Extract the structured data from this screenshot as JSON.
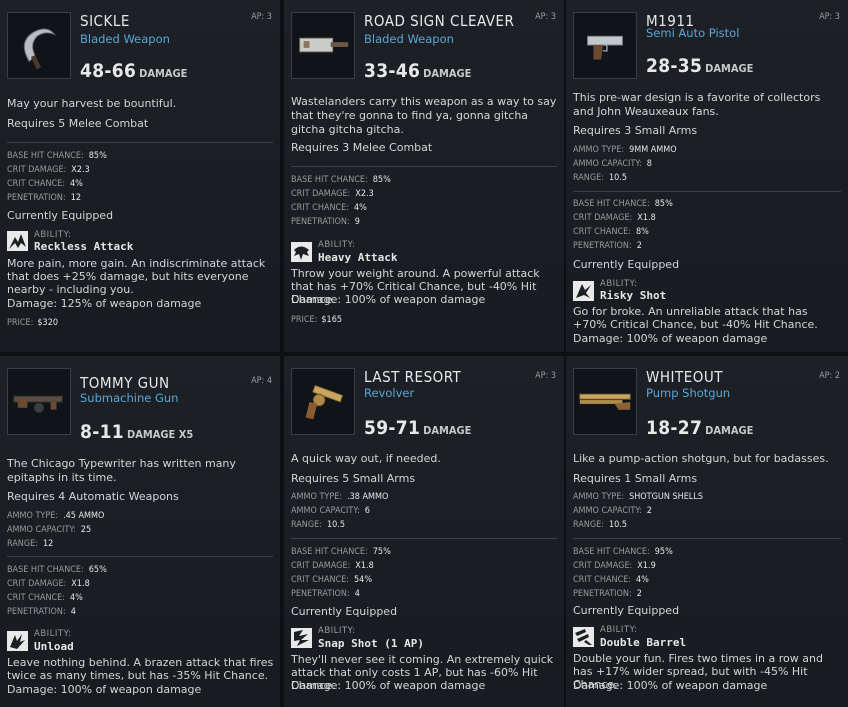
{
  "cards": [
    {
      "name": "SICKLE",
      "weapon_type": "Bladed Weapon",
      "ap": "AP: 3",
      "damage_value": "48-66",
      "damage_label": "DAMAGE",
      "flavor": "May your harvest be bountiful.",
      "requires": "Requires 5 Melee Combat",
      "stats": [
        {
          "label": "Base Hit Chance:",
          "value": "85%"
        },
        {
          "label": "Crit Damage:",
          "value": "X2.3"
        },
        {
          "label": "Crit Chance:",
          "value": "4%"
        },
        {
          "label": "Penetration:",
          "value": "12"
        }
      ],
      "equipped": "Currently Equipped",
      "ability_label": "ABILITY:",
      "ability_name": "Reckless Attack",
      "ability_desc": "More pain, more gain. An indiscriminate attack that does +25% damage, but hits everyone nearby - including you.",
      "ability_damage": "Damage: 125% of weapon damage",
      "price_label": "PRICE:",
      "price_value": "$320"
    },
    {
      "name": "ROAD SIGN CLEAVER",
      "weapon_type": "Bladed Weapon",
      "ap": "AP: 3",
      "damage_value": "33-46",
      "damage_label": "DAMAGE",
      "flavor": "Wastelanders carry this weapon as a way to say that they're gonna to find ya, gonna gitcha gitcha gitcha gitcha.",
      "requires": "Requires 3 Melee Combat",
      "stats": [
        {
          "label": "Base Hit Chance:",
          "value": "85%"
        },
        {
          "label": "Crit Damage:",
          "value": "X2.3"
        },
        {
          "label": "Crit Chance:",
          "value": "4%"
        },
        {
          "label": "Penetration:",
          "value": "9"
        }
      ],
      "ability_label": "ABILITY:",
      "ability_name": "Heavy Attack",
      "ability_desc": "Throw your weight around. A powerful attack that has +70% Critical Chance, but -40% Hit Chance.",
      "ability_damage": "Damage: 100% of weapon damage",
      "price_label": "PRICE:",
      "price_value": "$165"
    },
    {
      "name": "M1911",
      "weapon_type": "Semi Auto Pistol",
      "ap": "AP: 3",
      "damage_value": "28-35",
      "damage_label": "DAMAGE",
      "flavor": "This pre-war design is a favorite of collectors and John Weauxeaux fans.",
      "requires": "Requires 3 Small Arms",
      "ammo": [
        {
          "label": "Ammo Type:",
          "value": "9MM AMMO"
        },
        {
          "label": "Ammo Capacity:",
          "value": "8"
        },
        {
          "label": "Range:",
          "value": "10.5"
        }
      ],
      "stats": [
        {
          "label": "Base Hit Chance:",
          "value": "85%"
        },
        {
          "label": "Crit Damage:",
          "value": "X1.8"
        },
        {
          "label": "Crit Chance:",
          "value": "8%"
        },
        {
          "label": "Penetration:",
          "value": "2"
        }
      ],
      "equipped": "Currently Equipped",
      "ability_label": "ABILITY:",
      "ability_name": "Risky Shot",
      "ability_desc": "Go for broke. An unreliable attack that has +70% Critical Chance, but -40% Hit Chance.",
      "ability_damage": "Damage: 100% of weapon damage"
    },
    {
      "name": "TOMMY GUN",
      "weapon_type": "Submachine Gun",
      "ap": "AP: 4",
      "damage_value": "8-11",
      "damage_label": "DAMAGE X5",
      "flavor": "The Chicago Typewriter has written many epitaphs in its time.",
      "requires": "Requires 4 Automatic Weapons",
      "ammo": [
        {
          "label": "Ammo Type:",
          "value": ".45 AMMO"
        },
        {
          "label": "Ammo Capacity:",
          "value": "25"
        },
        {
          "label": "Range:",
          "value": "12"
        }
      ],
      "stats": [
        {
          "label": "Base Hit Chance:",
          "value": "65%"
        },
        {
          "label": "Crit Damage:",
          "value": "X1.8"
        },
        {
          "label": "Crit Chance:",
          "value": "4%"
        },
        {
          "label": "Penetration:",
          "value": "4"
        }
      ],
      "ability_label": "ABILITY:",
      "ability_name": "Unload",
      "ability_desc": "Leave nothing behind. A brazen attack that fires twice as many times, but has -35% Hit Chance.",
      "ability_damage": "Damage: 100% of weapon damage"
    },
    {
      "name": "LAST RESORT",
      "weapon_type": "Revolver",
      "ap": "AP: 3",
      "damage_value": "59-71",
      "damage_label": "DAMAGE",
      "flavor": "A quick way out, if needed.",
      "requires": "Requires 5 Small Arms",
      "ammo": [
        {
          "label": "Ammo Type:",
          "value": ".38 AMMO"
        },
        {
          "label": "Ammo Capacity:",
          "value": "6"
        },
        {
          "label": "Range:",
          "value": "10.5"
        }
      ],
      "stats": [
        {
          "label": "Base Hit Chance:",
          "value": "75%"
        },
        {
          "label": "Crit Damage:",
          "value": "X1.8"
        },
        {
          "label": "Crit Chance:",
          "value": "54%"
        },
        {
          "label": "Penetration:",
          "value": "4"
        }
      ],
      "equipped": "Currently Equipped",
      "ability_label": "ABILITY:",
      "ability_name": "Snap Shot (1 AP)",
      "ability_desc": "They'll never see it coming. An extremely quick attack that only costs 1 AP, but has -60% Hit Chance.",
      "ability_damage": "Damage: 100% of weapon damage"
    },
    {
      "name": "WHITEOUT",
      "weapon_type": "Pump Shotgun",
      "ap": "AP: 2",
      "damage_value": "18-27",
      "damage_label": "DAMAGE",
      "flavor": "Like a pump-action shotgun, but for badasses.",
      "requires": "Requires 1 Small Arms",
      "ammo": [
        {
          "label": "Ammo Type:",
          "value": "SHOTGUN SHELLS"
        },
        {
          "label": "Ammo Capacity:",
          "value": "2"
        },
        {
          "label": "Range:",
          "value": "10.5"
        }
      ],
      "stats": [
        {
          "label": "Base Hit Chance:",
          "value": "95%"
        },
        {
          "label": "Crit Damage:",
          "value": "X1.9"
        },
        {
          "label": "Crit Chance:",
          "value": "4%"
        },
        {
          "label": "Penetration:",
          "value": "2"
        }
      ],
      "equipped": "Currently Equipped",
      "ability_label": "ABILITY:",
      "ability_name": "Double Barrel",
      "ability_desc": "Double your fun. Fires two times in a row and has +17% wider spread, but with -45% Hit Chance.",
      "ability_damage": "Damage: 100% of weapon damage"
    }
  ]
}
